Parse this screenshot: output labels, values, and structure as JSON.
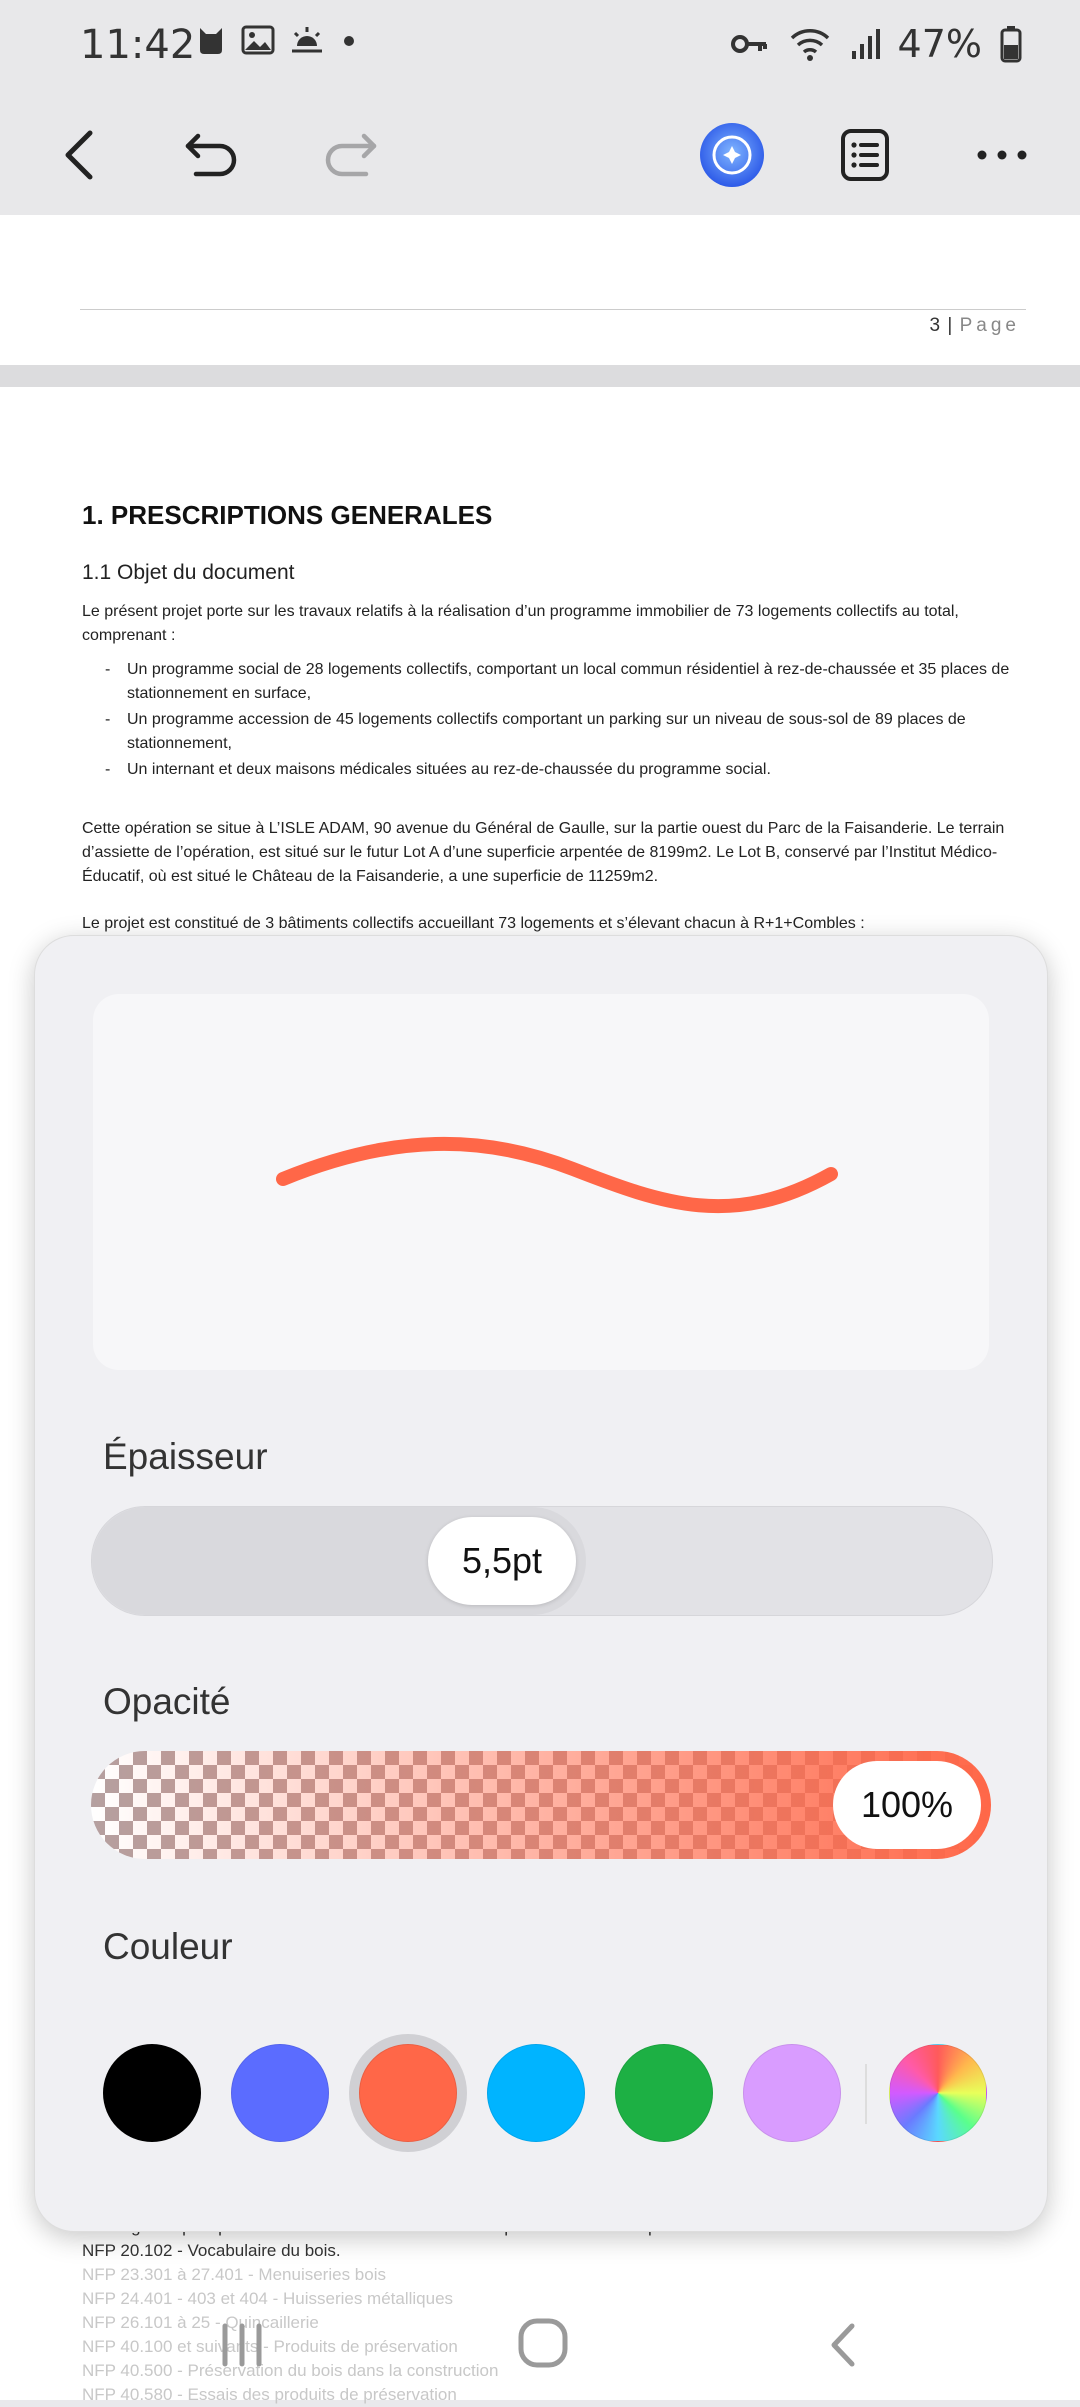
{
  "status_bar": {
    "time": "11:42",
    "battery": "47%"
  },
  "toolbar": {
    "back": "back-button",
    "undo": "undo-button",
    "redo": "redo-button",
    "ai": "ai-assistant-button",
    "list": "list-view-button",
    "more": "more-button"
  },
  "document": {
    "page_number": "3",
    "page_label": "Page",
    "heading1": "1. PRESCRIPTIONS GENERALES",
    "heading2": "1.1 Objet du document",
    "intro": "Le présent projet porte sur les travaux relatifs à la réalisation d’un programme immobilier de 73 logements collectifs au total, comprenant :",
    "bullets": [
      "Un programme social de 28 logements collectifs, comportant un local commun résidentiel à rez-de-chaussée et 35 places de stationnement en surface,",
      "Un programme accession de 45 logements collectifs comportant un parking sur un niveau de sous-sol de 89 places de stationnement,",
      "Un internant et deux maisons médicales situées au rez-de-chaussée du programme social."
    ],
    "para2": "Cette opération se situe à L’ISLE ADAM, 90 avenue du Général de Gaulle, sur la partie ouest du Parc de la Faisanderie. Le terrain d’assiette de l’opération, est situé sur le futur Lot A d’une superficie arpentée de 8199m2. Le Lot B, conservé par l’Institut Médico-Éducatif, où est situé le Château de la Faisanderie, a une superficie de 11259m2.",
    "para3": "Le projet est constitué de 3 bâtiments collectifs accueillant 73 logements et s’élevant chacun à R+1+Combles :",
    "bottom_line1": "envisagés et plus particulièrement les normes NF ainsi que les normes et après et leurs subdivisions :",
    "bottom_line2": "NFP 20.102 - Vocabulaire du bois.",
    "bottom_faded": [
      "NFP 23.301 à 27.401 - Menuiseries bois",
      "NFP 24.401 - 403 et 404 - Huisseries métalliques",
      "NFP 26.101 à 25 - Quincaillerie",
      "NFP 40.100 et suivants - Produits de préservation",
      "NFP 40.500 - Préservation du bois dans la construction",
      "NFP 40.580 - Essais des produits de préservation"
    ]
  },
  "pen_panel": {
    "thickness_label": "Épaisseur",
    "thickness_value": "5,5pt",
    "thickness_fraction": 0.5,
    "opacity_label": "Opacité",
    "opacity_value": "100%",
    "color_label": "Couleur",
    "stroke_color": "#FF6748",
    "colors": [
      {
        "name": "black",
        "hex": "#000000"
      },
      {
        "name": "blue",
        "hex": "#5B6CFF"
      },
      {
        "name": "orange-red",
        "hex": "#FF6748",
        "selected": true
      },
      {
        "name": "light-blue",
        "hex": "#00B4FF"
      },
      {
        "name": "green",
        "hex": "#1DB044"
      },
      {
        "name": "lavender",
        "hex": "#D99CFF"
      },
      {
        "name": "custom-spectrum",
        "hex": "spectrum"
      }
    ]
  }
}
